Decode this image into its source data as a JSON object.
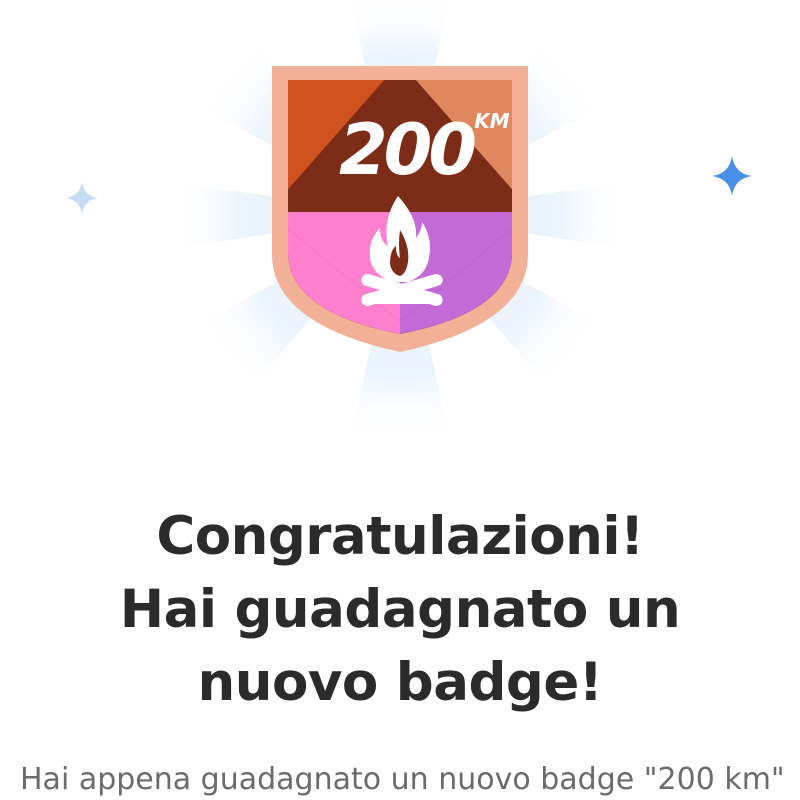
{
  "badge": {
    "value": "200",
    "unit": "KM",
    "icon": "campfire-icon",
    "colors": {
      "rim": "#f2b096",
      "top_left": "#c8491c",
      "top_right": "#e0875f",
      "center": "#7d2c18",
      "pink": "#ff7fcf",
      "purple": "#c36ad6",
      "bottom": "#e3643a"
    }
  },
  "headline": {
    "line1": "Congratulazioni!",
    "line2": "Hai guadagnato un",
    "line3": "nuovo badge!"
  },
  "body": {
    "text": "Hai appena guadagnato un nuovo badge \"200 km\""
  },
  "colors": {
    "sparkle_blue": "#4a90e8",
    "sparkle_light": "#b9d4f2",
    "ray_color": "#e6f0fb",
    "text_dark": "#2b2b2b",
    "text_gray": "#6b6b6b"
  }
}
